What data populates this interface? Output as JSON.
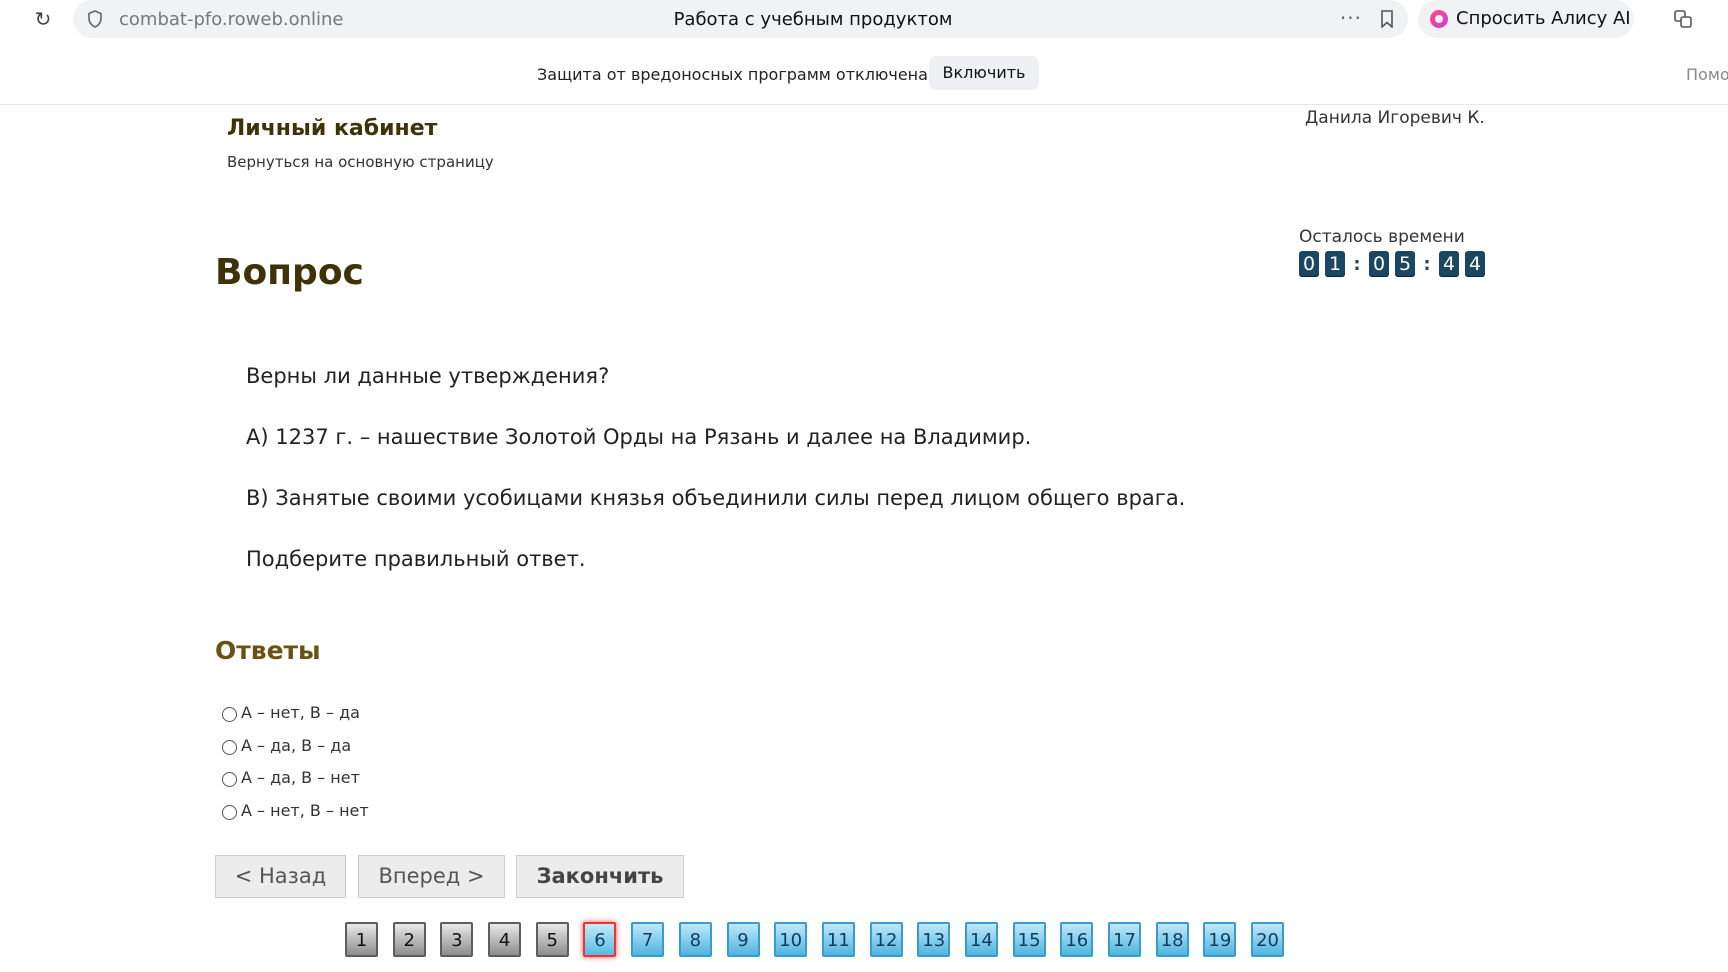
{
  "browser": {
    "url": "combat-pfo.roweb.online",
    "tab_title": "Работа с учебным продуктом",
    "more": "···",
    "alice_label": "Спросить Алису AI"
  },
  "notice": {
    "text": "Защита от вредоносных программ отключена",
    "enable_label": "Включить",
    "help_label": "Помо"
  },
  "header": {
    "cabinet_title": "Личный кабинет",
    "back_link": "Вернуться на основную страницу",
    "user_name": "Данила Игоревич К."
  },
  "timer": {
    "label": "Осталось времени",
    "digits": [
      "0",
      "1",
      "0",
      "5",
      "4",
      "4"
    ],
    "separator": ":"
  },
  "question": {
    "heading": "Вопрос",
    "lines": [
      "Верны ли данные утверждения?",
      "А) 1237 г. – нашествие Золотой Орды на Рязань и далее на Владимир.",
      "В) Занятые своими усобицами князья объединили силы перед лицом общего врага.",
      "Подберите правильный ответ."
    ]
  },
  "answers": {
    "heading": "Ответы",
    "options": [
      "А – нет, В – да",
      "А – да, В – да",
      "А – да, В – нет",
      "А – нет, В – нет"
    ]
  },
  "nav": {
    "back": "< Назад",
    "next": "Вперед >",
    "finish": "Закончить"
  },
  "pager": {
    "pages": [
      "1",
      "2",
      "3",
      "4",
      "5",
      "6",
      "7",
      "8",
      "9",
      "10",
      "11",
      "12",
      "13",
      "14",
      "15",
      "16",
      "17",
      "18",
      "19",
      "20"
    ],
    "answered": [
      "1",
      "2",
      "3",
      "4",
      "5"
    ],
    "current": "6"
  }
}
